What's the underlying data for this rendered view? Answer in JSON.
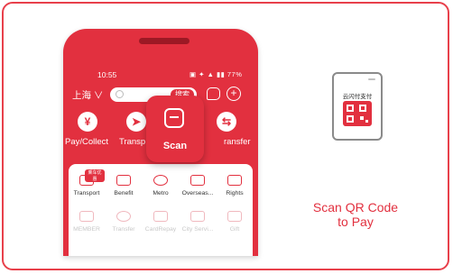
{
  "phone": {
    "status": {
      "time": "10:55",
      "battery": "77%"
    },
    "topbar": {
      "city": "上海 ∨",
      "search_button": "搜索"
    },
    "quick_actions": [
      {
        "label": "Pay/Collect",
        "icon": "yen-icon"
      },
      {
        "label": "Transp",
        "icon": "send-icon"
      },
      {
        "label": "ransfer",
        "icon": "transfer-icon"
      }
    ],
    "scan": {
      "label": "Scan",
      "icon": "scan-icon"
    },
    "services": [
      {
        "label": "Transport",
        "badge": "乘车优惠"
      },
      {
        "label": "Benefit"
      },
      {
        "label": "Metro"
      },
      {
        "label": "Overseas..."
      },
      {
        "label": "Rights"
      }
    ],
    "services_faded": [
      {
        "label": "MEMBER"
      },
      {
        "label": "Transfer"
      },
      {
        "label": "CardRepay"
      },
      {
        "label": "City Servi..."
      },
      {
        "label": "Gift"
      }
    ]
  },
  "mini_phone": {
    "header_text": "云闪付支付"
  },
  "caption": {
    "line1": "Scan QR Code",
    "line2": "to Pay"
  },
  "colors": {
    "brand_red": "#e2303f",
    "frame_red": "#e8404b"
  }
}
